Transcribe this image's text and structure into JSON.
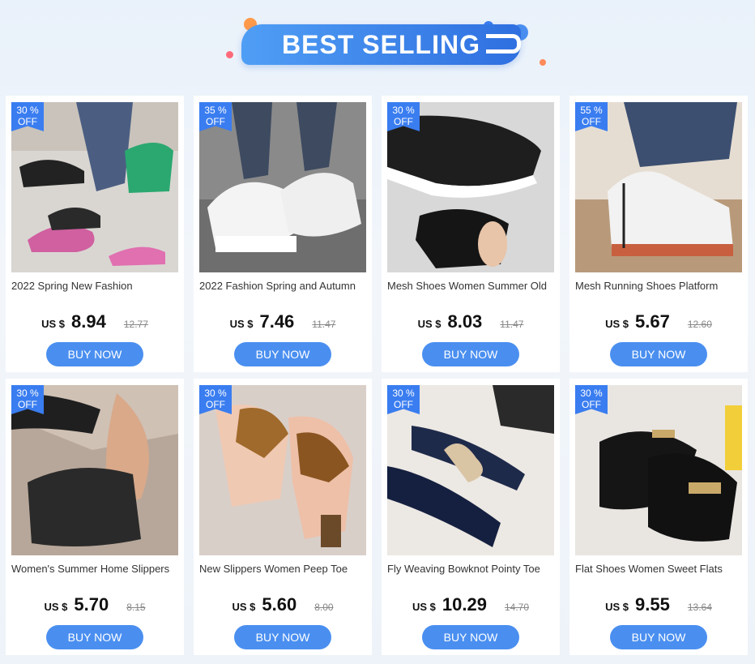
{
  "header": {
    "title": "BEST SELLING"
  },
  "products": [
    {
      "badge_pct": "30 %",
      "badge_off": "OFF",
      "title": "2022 Spring New Fashion",
      "currency": "US $",
      "price": "8.94",
      "old_price": "12.77",
      "button": "BUY NOW"
    },
    {
      "badge_pct": "35 %",
      "badge_off": "OFF",
      "title": "2022 Fashion Spring and Autumn",
      "currency": "US $",
      "price": "7.46",
      "old_price": "11.47",
      "button": "BUY NOW"
    },
    {
      "badge_pct": "30 %",
      "badge_off": "OFF",
      "title": "Mesh Shoes Women Summer Old",
      "currency": "US $",
      "price": "8.03",
      "old_price": "11.47",
      "button": "BUY NOW"
    },
    {
      "badge_pct": "55 %",
      "badge_off": "OFF",
      "title": "Mesh Running Shoes Platform",
      "currency": "US $",
      "price": "5.67",
      "old_price": "12.60",
      "button": "BUY NOW"
    },
    {
      "badge_pct": "30 %",
      "badge_off": "OFF",
      "title": "Women's Summer Home Slippers",
      "currency": "US $",
      "price": "5.70",
      "old_price": "8.15",
      "button": "BUY NOW"
    },
    {
      "badge_pct": "30 %",
      "badge_off": "OFF",
      "title": "New Slippers Women Peep Toe",
      "currency": "US $",
      "price": "5.60",
      "old_price": "8.00",
      "button": "BUY NOW"
    },
    {
      "badge_pct": "30 %",
      "badge_off": "OFF",
      "title": "Fly Weaving Bowknot Pointy Toe",
      "currency": "US $",
      "price": "10.29",
      "old_price": "14.70",
      "button": "BUY NOW"
    },
    {
      "badge_pct": "30 %",
      "badge_off": "OFF",
      "title": "Flat Shoes Women Sweet Flats",
      "currency": "US $",
      "price": "9.55",
      "old_price": "13.64",
      "button": "BUY NOW"
    }
  ]
}
